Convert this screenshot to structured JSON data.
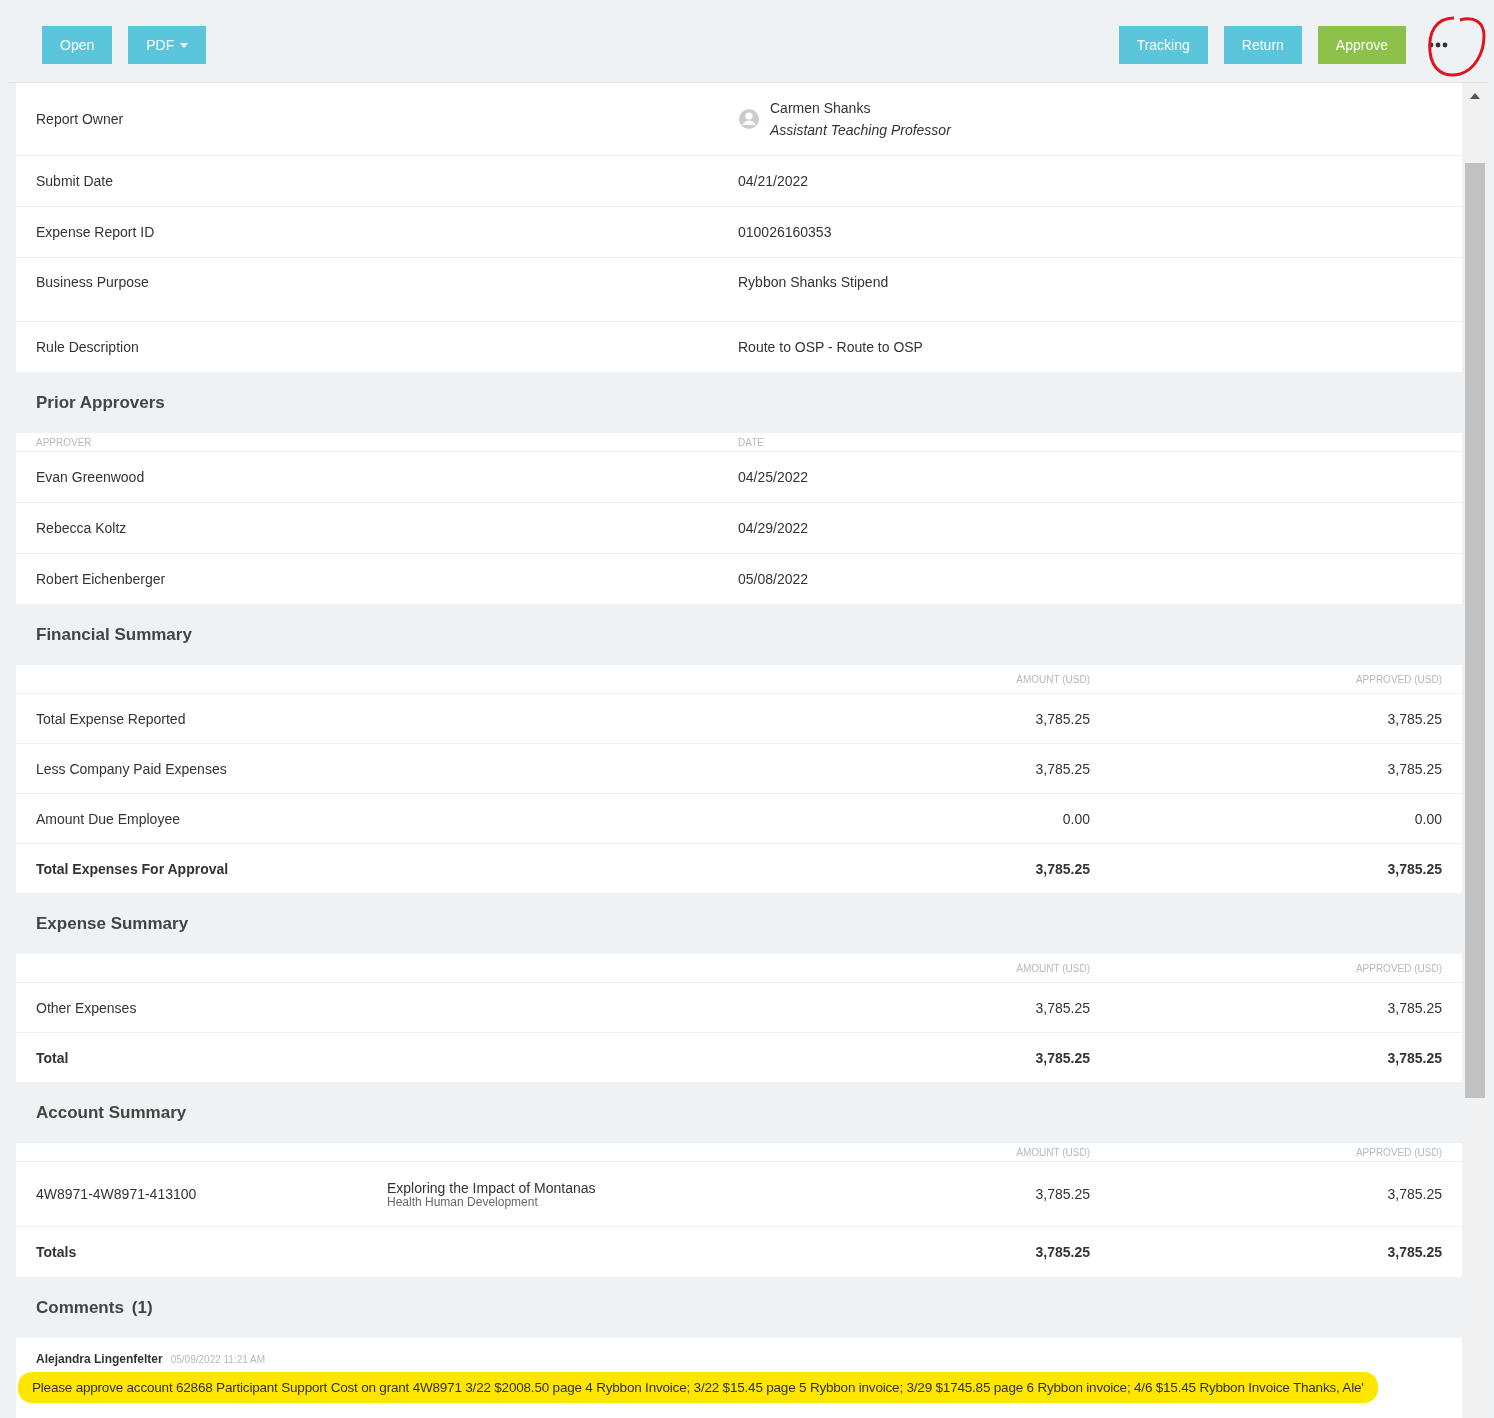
{
  "toolbar": {
    "left_buttons": [
      {
        "label": "Open",
        "kind": "plain"
      },
      {
        "label": "PDF",
        "kind": "dropdown"
      }
    ],
    "right_buttons": [
      {
        "label": "Tracking",
        "kind": "info"
      },
      {
        "label": "Return",
        "kind": "info"
      },
      {
        "label": "Approve",
        "kind": "success"
      }
    ]
  },
  "details": [
    {
      "label": "Report Owner",
      "kind": "person",
      "value": "Carmen Shanks",
      "subtitle": "Assistant Teaching Professor"
    },
    {
      "label": "Submit Date",
      "kind": "text",
      "value": "04/21/2022"
    },
    {
      "label": "Expense Report ID",
      "kind": "text",
      "value": "010026160353"
    },
    {
      "label": "Business Purpose",
      "kind": "tall",
      "value": "Rybbon Shanks Stipend"
    },
    {
      "label": "Rule Description",
      "kind": "text",
      "value": "Route to OSP - Route to OSP"
    }
  ],
  "prior_approvers": {
    "title": "Prior Approvers",
    "columns": [
      "APPROVER",
      "DATE"
    ],
    "rows": [
      {
        "approver": "Evan Greenwood",
        "date": "04/25/2022"
      },
      {
        "approver": "Rebecca Koltz",
        "date": "04/29/2022"
      },
      {
        "approver": "Robert Eichenberger",
        "date": "05/08/2022"
      }
    ]
  },
  "financial_summary": {
    "title": "Financial Summary",
    "columns": [
      "AMOUNT (USD)",
      "APPROVED (USD)"
    ],
    "rows": [
      {
        "label": "Total Expense Reported",
        "amount": "3,785.25",
        "approved": "3,785.25",
        "total": false
      },
      {
        "label": "Less Company Paid Expenses",
        "amount": "3,785.25",
        "approved": "3,785.25",
        "total": false
      },
      {
        "label": "Amount Due Employee",
        "amount": "0.00",
        "approved": "0.00",
        "total": false
      },
      {
        "label": "Total Expenses For Approval",
        "amount": "3,785.25",
        "approved": "3,785.25",
        "total": true
      }
    ]
  },
  "expense_summary": {
    "title": "Expense Summary",
    "columns": [
      "AMOUNT (USD)",
      "APPROVED (USD)"
    ],
    "rows": [
      {
        "label": "Other Expenses",
        "amount": "3,785.25",
        "approved": "3,785.25",
        "total": false
      },
      {
        "label": "Total",
        "amount": "3,785.25",
        "approved": "3,785.25",
        "total": true
      }
    ]
  },
  "account_summary": {
    "title": "Account Summary",
    "columns": [
      "AMOUNT (USD)",
      "APPROVED (USD)"
    ],
    "rows": [
      {
        "account": "4W8971-4W8971-413100",
        "description": "Exploring the Impact of Montanas",
        "department": "Health Human Development",
        "amount": "3,785.25",
        "approved": "3,785.25"
      }
    ],
    "totals": {
      "label": "Totals",
      "amount": "3,785.25",
      "approved": "3,785.25"
    }
  },
  "comments": {
    "title": "Comments",
    "count": "(1)",
    "items": [
      {
        "author": "Alejandra Lingenfelter",
        "timestamp": "05/09/2022 11:21 AM",
        "text": "Please approve account 62868 Participant Support Cost on grant 4W8971 3/22 $2008.50 page 4 Rybbon  Invoice; 3/22 $15.45 page 5 Rybbon invoice; 3/29 $1745.85 page 6 Rybbon invoice; 4/6 $15.45 Rybbon Invoice Thanks, Ale'"
      }
    ]
  }
}
